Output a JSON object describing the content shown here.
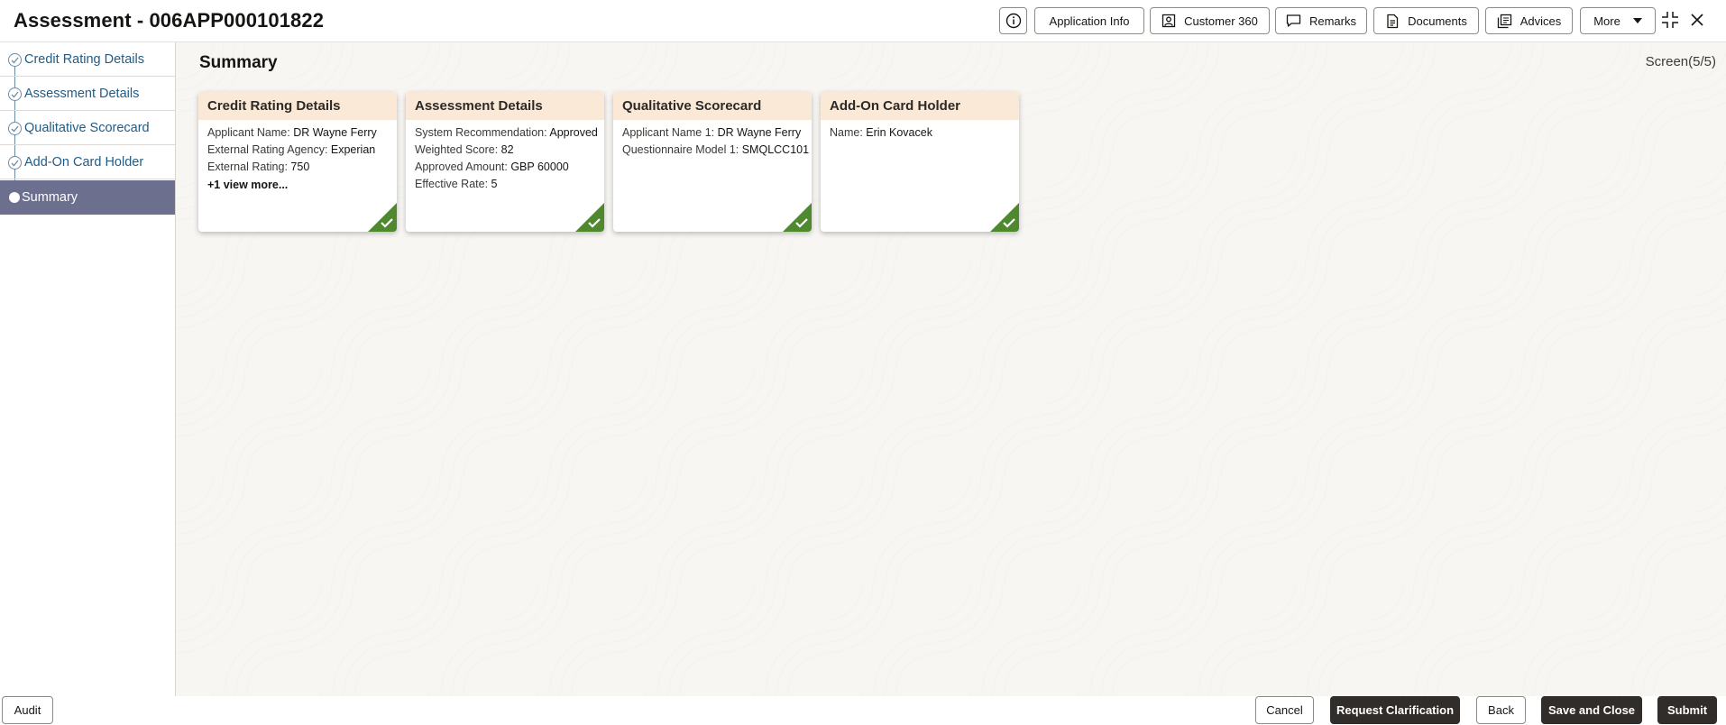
{
  "header": {
    "title": "Assessment - 006APP000101822",
    "buttons": {
      "info_icon": "info-icon",
      "application_info": "Application Info",
      "customer_360": "Customer 360",
      "remarks": "Remarks",
      "documents": "Documents",
      "advices": "Advices",
      "more": "More"
    }
  },
  "sidebar": {
    "items": [
      {
        "label": "Credit Rating Details",
        "state": "completed"
      },
      {
        "label": "Assessment Details",
        "state": "completed"
      },
      {
        "label": "Qualitative Scorecard",
        "state": "completed"
      },
      {
        "label": "Add-On Card Holder",
        "state": "completed"
      },
      {
        "label": "Summary",
        "state": "active"
      }
    ]
  },
  "main": {
    "title": "Summary",
    "screen_count": "Screen(5/5)",
    "cards": [
      {
        "title": "Credit Rating Details",
        "rows": [
          {
            "key": "Applicant Name: ",
            "value": "DR Wayne Ferry"
          },
          {
            "key": "External Rating Agency: ",
            "value": "Experian"
          },
          {
            "key": "External Rating: ",
            "value": "750"
          }
        ],
        "view_more": "+1 view more..."
      },
      {
        "title": "Assessment Details",
        "rows": [
          {
            "key": "System Recommendation: ",
            "value": "Approved"
          },
          {
            "key": "Weighted Score: ",
            "value": "82"
          },
          {
            "key": "Approved Amount: ",
            "value": "GBP 60000"
          },
          {
            "key": "Effective Rate: ",
            "value": "5"
          }
        ]
      },
      {
        "title": "Qualitative Scorecard",
        "rows": [
          {
            "key": "Applicant Name 1: ",
            "value": "DR Wayne Ferry"
          },
          {
            "key": "Questionnaire Model 1: ",
            "value": "SMQLCC101"
          }
        ]
      },
      {
        "title": "Add-On Card Holder",
        "rows": [
          {
            "key": "Name: ",
            "value": "Erin Kovacek"
          }
        ]
      }
    ]
  },
  "footer": {
    "audit": "Audit",
    "cancel": "Cancel",
    "request_clarification": "Request Clarification",
    "back": "Back",
    "save_and_close": "Save and Close",
    "submit": "Submit"
  },
  "colors": {
    "accent_active": "#6c6f8e",
    "card_header": "#fbe9d7",
    "complete_green": "#4e8a2d",
    "primary_button": "#312d2a",
    "link_blue": "#1f5c87"
  }
}
